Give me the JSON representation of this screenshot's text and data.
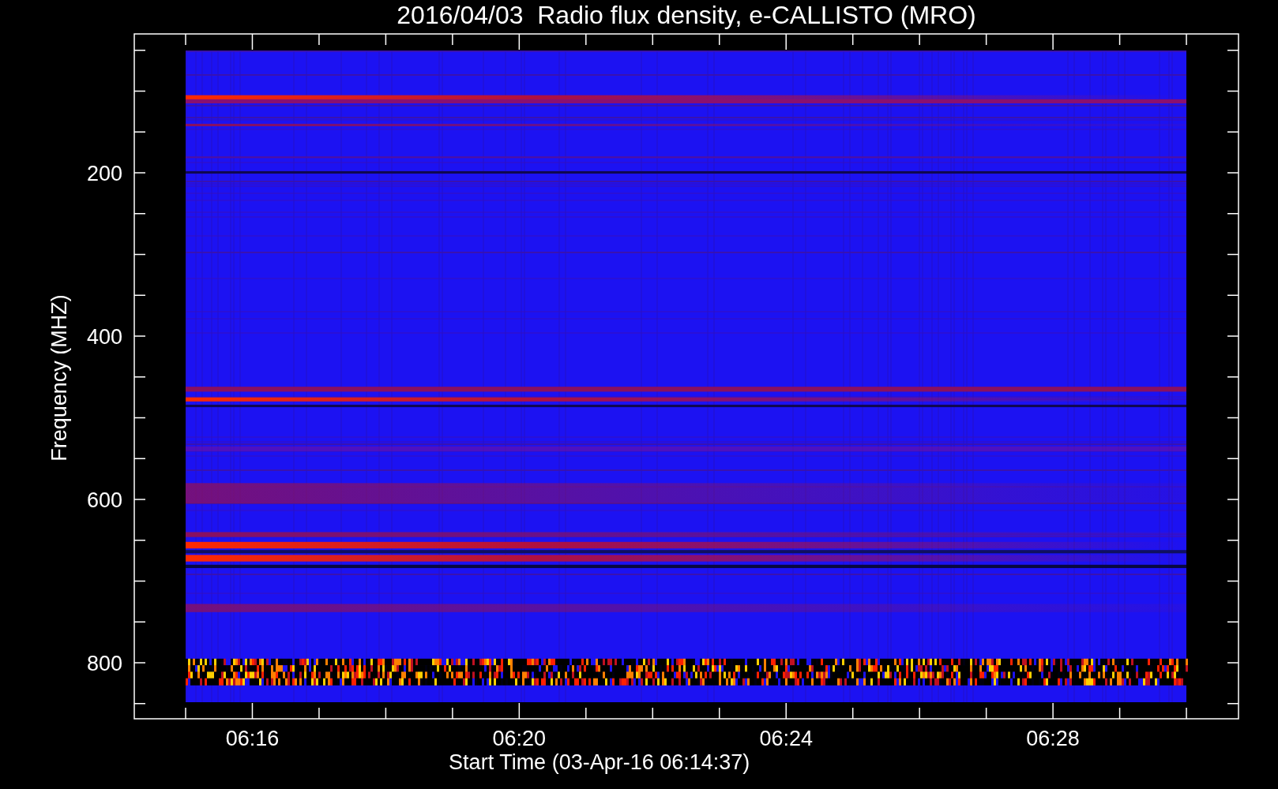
{
  "title": "2016/04/03  Radio flux density, e-CALLISTO (MRO)",
  "y_axis": {
    "label": "Frequency (MHZ)",
    "ticks": [
      "200",
      "400",
      "600",
      "800"
    ]
  },
  "x_axis": {
    "label": "Start Time (03-Apr-16 06:14:37)",
    "ticks": [
      "06:16",
      "06:20",
      "06:24",
      "06:28"
    ]
  }
}
